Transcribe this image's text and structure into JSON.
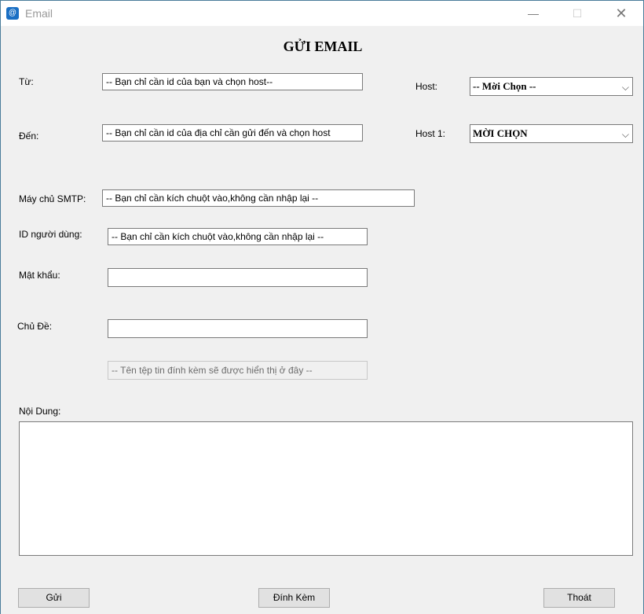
{
  "window": {
    "title": "Email",
    "icon": "email-app-icon"
  },
  "form": {
    "title": "GỬI EMAIL",
    "from_label": "Từ:",
    "from_value": "-- Bạn chỉ cần id của bạn và chọn host--",
    "to_label": "Đến:",
    "to_value": "-- Bạn chỉ cần id của địa chỉ cần gửi đến và chọn host",
    "host_label": "Host:",
    "host_value": "-- Mời Chọn --",
    "host1_label": "Host 1:",
    "host1_value": "MỜI CHỌN",
    "smtp_label": "Máy chủ SMTP:",
    "smtp_value": "-- Bạn chỉ cần kích chuột vào,không cần nhập lại --",
    "userid_label": "ID người dùng:",
    "userid_value": "-- Bạn chỉ cần kích chuột vào,không cần nhập lại --",
    "password_label": "Mật khẩu:",
    "password_value": "",
    "subject_label": "Chủ Đề:",
    "subject_value": "",
    "attachment_value": "-- Tên tệp tin đính kèm sẽ được hiển thị ở đây --",
    "content_label": "Nội Dung:",
    "content_value": ""
  },
  "buttons": {
    "send": "Gửi",
    "attach": "Đính Kèm",
    "exit": "Thoát"
  }
}
